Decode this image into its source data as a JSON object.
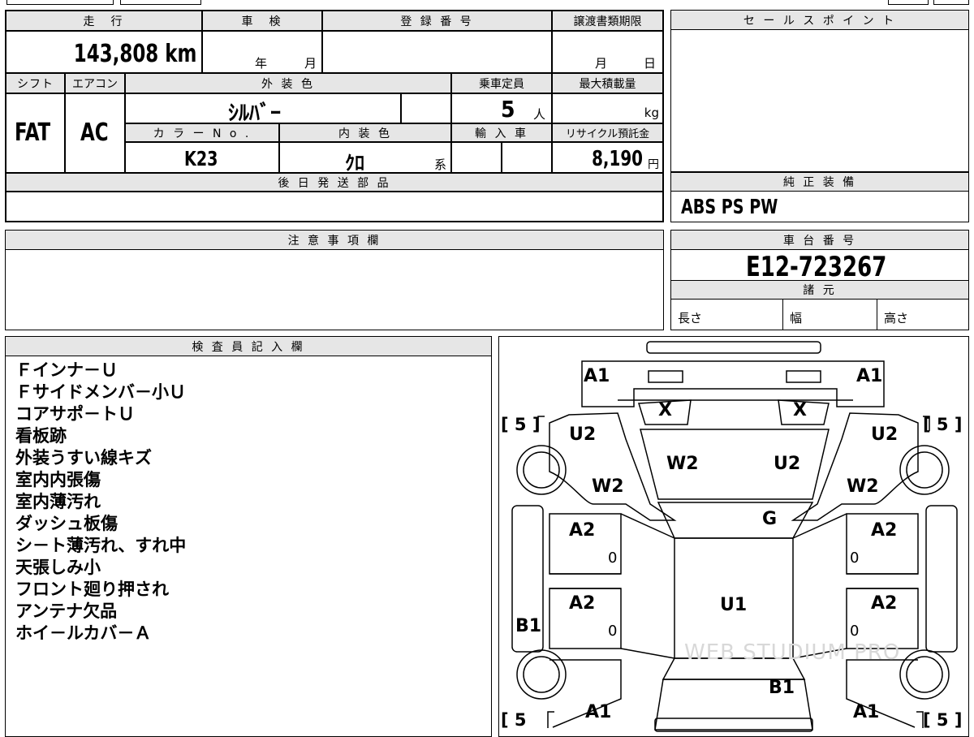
{
  "headers": {
    "mileage": "走　行",
    "inspection": "車　検",
    "registration": "登 録 番 号",
    "transfer_deadline": "譲渡書類期限",
    "sales_point": "セ ー ル ス ポ イ ン ト",
    "shift": "シフト",
    "aircon": "エアコン",
    "exterior_color": "外 装 色",
    "capacity": "乗車定員",
    "max_load": "最大積載量",
    "color_no": "カ ラ ー  N o .",
    "interior_color": "内 装 色",
    "import": "輸 入 車",
    "recycle_fee": "リサイクル預託金",
    "later_parts": "後 日 発 送 部 品",
    "oem_equipment": "純 正 装 備",
    "notes": "注 意 事 項 欄",
    "chassis_no": "車 台 番 号",
    "specs": "諸 元",
    "inspector": "検 査 員 記 入 欄"
  },
  "values": {
    "mileage": "143,808 km",
    "inspection_year": "年",
    "inspection_month": "月",
    "transfer_month": "月",
    "transfer_day": "日",
    "shift": "FAT",
    "aircon": "AC",
    "exterior_color": "ｼﾙﾊﾞｰ",
    "capacity": "5",
    "capacity_unit": "人",
    "max_load_unit": "kg",
    "color_no": "K23",
    "interior_color": "ｸﾛ",
    "interior_suffix": "系",
    "recycle_fee": "8,190",
    "recycle_unit": "円",
    "oem_equipment": "ABS PS PW",
    "chassis_no": "E12-723267",
    "length_label": "長さ",
    "width_label": "幅",
    "height_label": "高さ"
  },
  "inspector_remarks": [
    "Ｆインナ－Ｕ",
    "Ｆサイドメンバ－小Ｕ",
    "コアサポ－トＵ",
    "看板跡",
    "外装うすい線キズ",
    "室内内張傷",
    "室内薄汚れ",
    "ダッシュ板傷",
    "シ－ト薄汚れ、すれ中",
    "天張しみ小",
    "フロント廻り押され",
    "アンテナ欠品",
    "ホイ－ルカバ－Ａ"
  ],
  "diagram": {
    "a1_fl": "A1",
    "a1_fr": "A1",
    "a1_rl": "A1",
    "a1_rr": "A1",
    "x_left": "X",
    "x_right": "X",
    "u2_left": "U2",
    "u2_right": "U2",
    "w2_hood": "W2",
    "u2_hood": "U2",
    "w2_left": "W2",
    "w2_right": "W2",
    "g": "G",
    "a2_fl": "A2",
    "a2_fr": "A2",
    "a2_rl": "A2",
    "a2_rr": "A2",
    "b1_left": "B1",
    "u1": "U1",
    "b1_rear": "B1",
    "tire_fl": "[ 5 ]",
    "tire_fr": "[ 5 ]",
    "tire_rl": "[ 5",
    "tire_rr": "[ 5 ]",
    "zero1": "0",
    "zero2": "0",
    "zero3": "0",
    "zero4": "0",
    "watermark": "WEB STUDIUM PRO"
  }
}
